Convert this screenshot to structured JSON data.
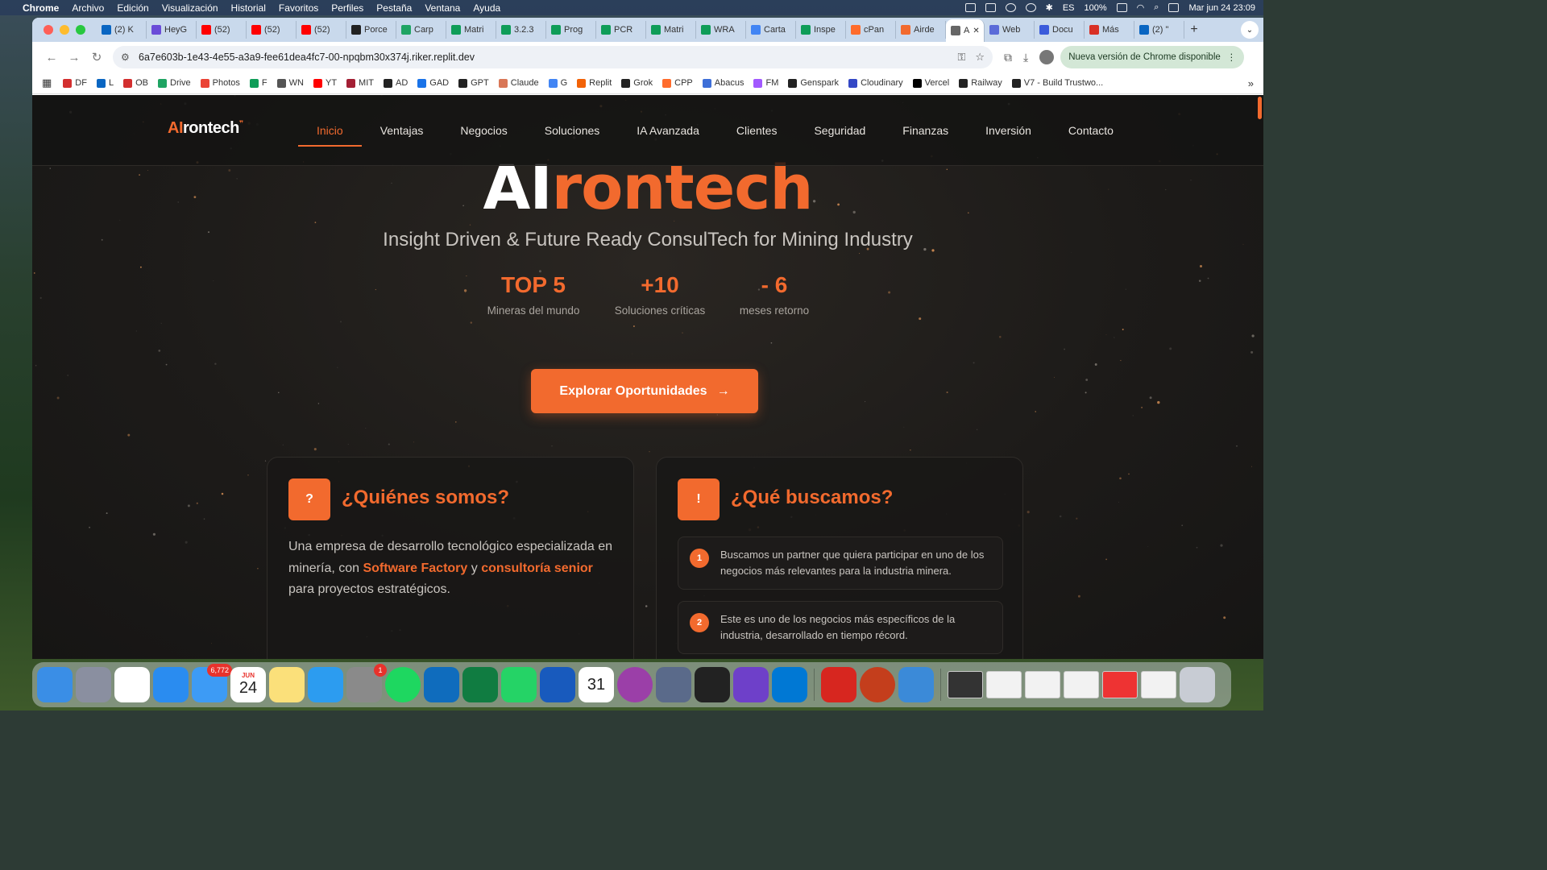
{
  "menubar": {
    "app": "Chrome",
    "items": [
      "Archivo",
      "Edición",
      "Visualización",
      "Historial",
      "Favoritos",
      "Perfiles",
      "Pestaña",
      "Ventana",
      "Ayuda"
    ],
    "lang": "ES",
    "battery": "100%",
    "datetime": "Mar jun 24  23:09"
  },
  "tabs": [
    {
      "label": "(2) K",
      "color": "#0a66c2"
    },
    {
      "label": "HeyG",
      "color": "#6a4cd8"
    },
    {
      "label": "(52)",
      "color": "#ff0000"
    },
    {
      "label": "(52)",
      "color": "#ff0000"
    },
    {
      "label": "(52)",
      "color": "#ff0000"
    },
    {
      "label": "Porce",
      "color": "#222222"
    },
    {
      "label": "Carp",
      "color": "#1fa463"
    },
    {
      "label": "Matri",
      "color": "#0f9d58"
    },
    {
      "label": "3.2.3",
      "color": "#0f9d58"
    },
    {
      "label": "Prog",
      "color": "#0f9d58"
    },
    {
      "label": "PCR",
      "color": "#0f9d58"
    },
    {
      "label": "Matri",
      "color": "#0f9d58"
    },
    {
      "label": "WRA",
      "color": "#0f9d58"
    },
    {
      "label": "Carta",
      "color": "#4285f4"
    },
    {
      "label": "Inspe",
      "color": "#0f9d58"
    },
    {
      "label": "cPan",
      "color": "#ff6c2c"
    },
    {
      "label": "Airde",
      "color": "#f26a2e"
    }
  ],
  "active_tab": {
    "label": "A"
  },
  "tabs_after": [
    {
      "label": "Web",
      "color": "#5b6bd8"
    },
    {
      "label": "Docu",
      "color": "#3b5bdb"
    },
    {
      "label": "Más",
      "color": "#d93025"
    },
    {
      "label": "(2) \"",
      "color": "#0a66c2"
    }
  ],
  "address": {
    "url": "6a7e603b-1e43-4e55-a3a9-fee61dea4fc7-00-npqbm30x374j.riker.replit.dev",
    "update": "Nueva versión de Chrome disponible"
  },
  "bookmarks": [
    {
      "label": "DF",
      "color": "#d32f2f"
    },
    {
      "label": "L",
      "color": "#0a66c2"
    },
    {
      "label": "OB",
      "color": "#d32f2f"
    },
    {
      "label": "Drive",
      "color": "#1fa463"
    },
    {
      "label": "Photos",
      "color": "#ea4335"
    },
    {
      "label": "F",
      "color": "#0f9d58"
    },
    {
      "label": "WN",
      "color": "#555555"
    },
    {
      "label": "YT",
      "color": "#ff0000"
    },
    {
      "label": "MIT",
      "color": "#a31f34"
    },
    {
      "label": "AD",
      "color": "#222222"
    },
    {
      "label": "GAD",
      "color": "#1a73e8"
    },
    {
      "label": "GPT",
      "color": "#222222"
    },
    {
      "label": "Claude",
      "color": "#d97757"
    },
    {
      "label": "G",
      "color": "#4285f4"
    },
    {
      "label": "Replit",
      "color": "#f26207"
    },
    {
      "label": "Grok",
      "color": "#222222"
    },
    {
      "label": "CPP",
      "color": "#ff6c2c"
    },
    {
      "label": "Abacus",
      "color": "#3e6fd8"
    },
    {
      "label": "FM",
      "color": "#a259ff"
    },
    {
      "label": "Genspark",
      "color": "#222222"
    },
    {
      "label": "Cloudinary",
      "color": "#3448c5"
    },
    {
      "label": "Vercel",
      "color": "#000000"
    },
    {
      "label": "Railway",
      "color": "#222222"
    },
    {
      "label": "V7 - Build Trustwo...",
      "color": "#222222"
    }
  ],
  "site": {
    "logo": {
      "ai": "AI",
      "rest": "rontech",
      "sup": "❞"
    },
    "nav": [
      "Inicio",
      "Ventajas",
      "Negocios",
      "Soluciones",
      "IA Avanzada",
      "Clientes",
      "Seguridad",
      "Finanzas",
      "Inversión",
      "Contacto"
    ],
    "hero": {
      "title_white": "AI",
      "title_orange": "rontech"
    },
    "subtitle": "Insight Driven & Future Ready ConsulTech for Mining Industry",
    "stats": [
      {
        "value": "TOP 5",
        "label": "Mineras del mundo"
      },
      {
        "value": "+10",
        "label": "Soluciones críticas"
      },
      {
        "value": "- 6",
        "label": "meses retorno"
      }
    ],
    "cta": "Explorar Oportunidades",
    "card1": {
      "badge": "?",
      "title": "¿Quiénes somos?",
      "text_a": "Una empresa de desarrollo tecnológico especializada en minería, con ",
      "hl1": "Software Factory",
      "text_b": " y ",
      "hl2": "consultoría senior",
      "text_c": " para proyectos estratégicos."
    },
    "card2": {
      "badge": "!",
      "title": "¿Qué buscamos?",
      "items": [
        {
          "num": "1",
          "text": "Buscamos un partner que quiera participar en uno de los negocios más relevantes para la industria minera."
        },
        {
          "num": "2",
          "text": "Este es uno de los negocios más específicos de la industria, desarrollado en tiempo récord."
        }
      ]
    }
  },
  "dock": {
    "mail_badge": "6,772",
    "settings_badge": "1",
    "calendar_month": "JUN",
    "calendar_day": "24",
    "gcal_day": "31"
  },
  "colors": {
    "accent": "#f26a2e"
  }
}
